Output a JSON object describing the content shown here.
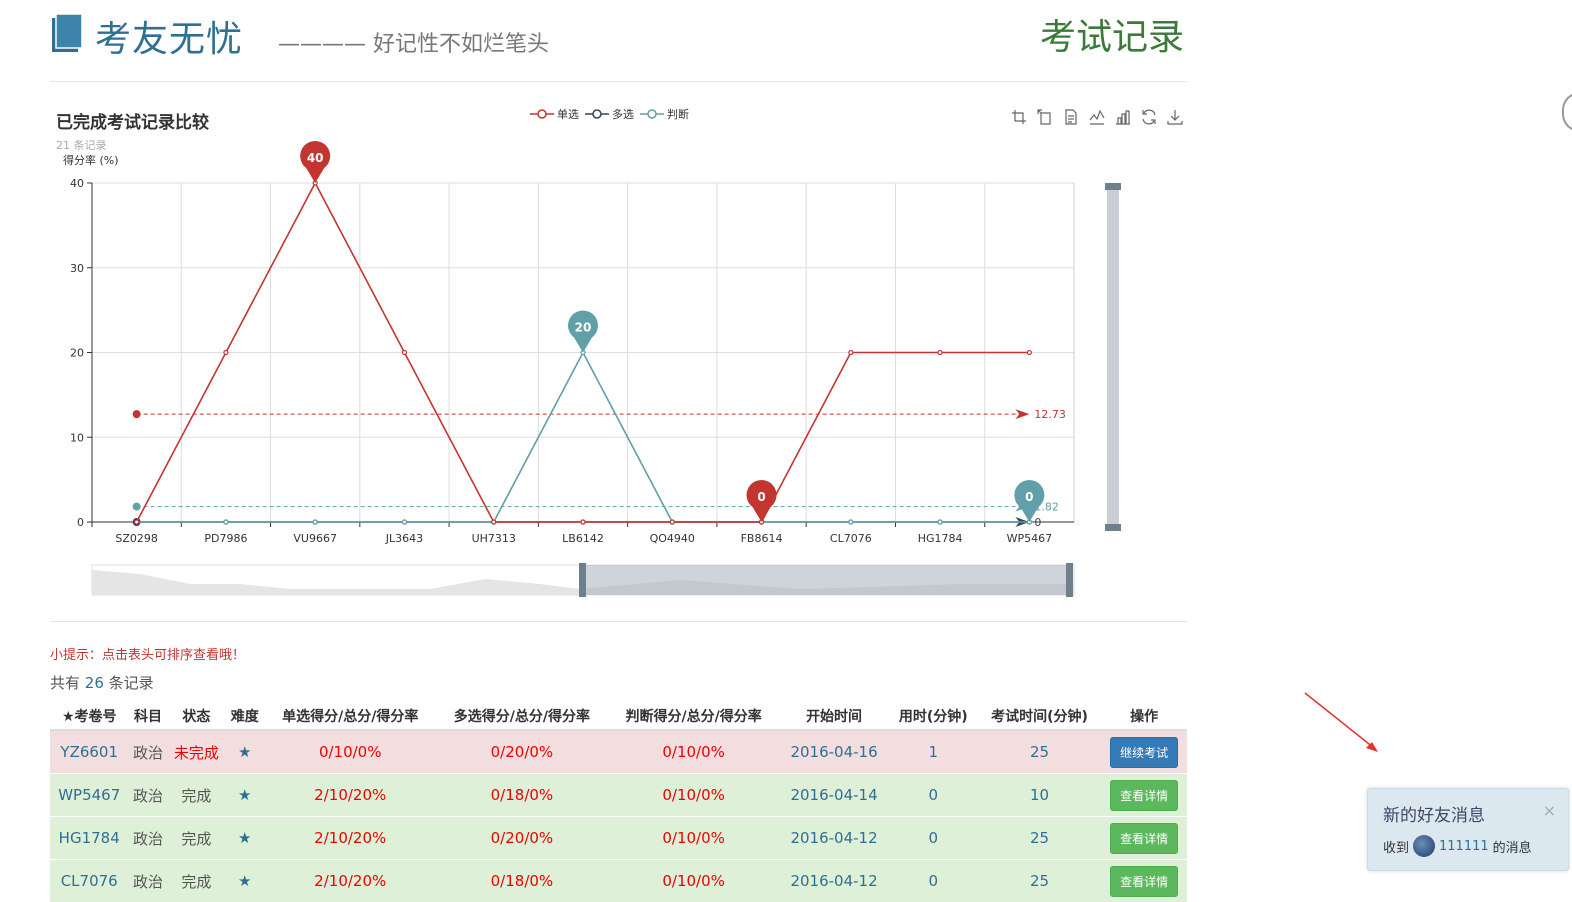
{
  "header": {
    "logo_text": "考友无忧",
    "slogan": "———— 好记性不如烂笔头",
    "page_title": "考试记录"
  },
  "chart_meta": {
    "record_count_text": "21 条记录"
  },
  "toolbox": [
    "area-zoom-icon",
    "zoom-reset-icon",
    "data-view-icon",
    "line-chart-icon",
    "bar-chart-icon",
    "restore-icon",
    "save-image-icon"
  ],
  "colors": {
    "single": "#c23531",
    "multi": "#2f4554",
    "judge": "#61a0a8",
    "brand": "#2f6f92",
    "title_green": "#3c7a3c"
  },
  "chart_data": {
    "type": "line",
    "title": "已完成考试记录比较",
    "subtitle": "21 条记录",
    "ylabel": "得分率 (%)",
    "categories": [
      "SZ0298",
      "PD7986",
      "VU9667",
      "JL3643",
      "UH7313",
      "LB6142",
      "QO4940",
      "FB8614",
      "CL7076",
      "HG1784",
      "WP5467"
    ],
    "ylim": [
      0,
      40
    ],
    "yticks": [
      0,
      10,
      20,
      30,
      40
    ],
    "grid": true,
    "legend_position": "top-center",
    "series": [
      {
        "name": "单选",
        "values": [
          0,
          20,
          40,
          20,
          0,
          0,
          0,
          0,
          20,
          20,
          20
        ],
        "mark_point_values": [
          40,
          0
        ],
        "average": 12.73
      },
      {
        "name": "多选",
        "values": [
          0,
          0,
          0,
          0,
          0,
          0,
          0,
          0,
          0,
          0,
          0
        ],
        "average": 0
      },
      {
        "name": "判断",
        "values": [
          0,
          0,
          0,
          0,
          0,
          20,
          0,
          0,
          0,
          0,
          0
        ],
        "mark_point_values": [
          20,
          0
        ],
        "average": 1.82
      }
    ]
  },
  "tip": "小提示：点击表头可排序查看哦！",
  "count": {
    "prefix": "共有 ",
    "value": "26",
    "suffix": " 条记录"
  },
  "table": {
    "headers": [
      "★考卷号",
      "科目",
      "状态",
      "难度",
      "单选得分/总分/得分率",
      "多选得分/总分/得分率",
      "判断得分/总分/得分率",
      "开始时间",
      "用时(分钟)",
      "考试时间(分钟)",
      "操作"
    ],
    "rows": [
      {
        "id": "YZ6601",
        "subject": "政治",
        "status": "未完成",
        "difficulty": "★",
        "single": "0/10/0%",
        "multi": "0/20/0%",
        "judge": "0/10/0%",
        "start": "2016-04-16",
        "used": "1",
        "duration": "25",
        "action": "继续考试"
      },
      {
        "id": "WP5467",
        "subject": "政治",
        "status": "完成",
        "difficulty": "★",
        "single": "2/10/20%",
        "multi": "0/18/0%",
        "judge": "0/10/0%",
        "start": "2016-04-14",
        "used": "0",
        "duration": "10",
        "action": "查看详情"
      },
      {
        "id": "HG1784",
        "subject": "政治",
        "status": "完成",
        "difficulty": "★",
        "single": "2/10/20%",
        "multi": "0/20/0%",
        "judge": "0/10/0%",
        "start": "2016-04-12",
        "used": "0",
        "duration": "25",
        "action": "查看详情"
      },
      {
        "id": "CL7076",
        "subject": "政治",
        "status": "完成",
        "difficulty": "★",
        "single": "2/10/20%",
        "multi": "0/18/0%",
        "judge": "0/10/0%",
        "start": "2016-04-12",
        "used": "0",
        "duration": "25",
        "action": "查看详情"
      }
    ]
  },
  "notification": {
    "title": "新的好友消息",
    "close": "×",
    "body_prefix": "收到",
    "body_user": "111111",
    "body_suffix": " 的消息"
  }
}
